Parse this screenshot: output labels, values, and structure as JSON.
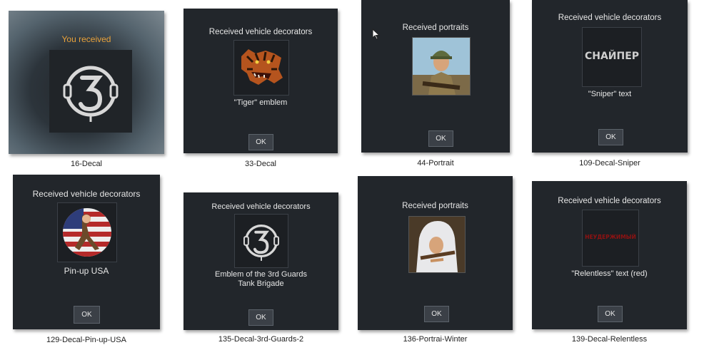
{
  "thumbnails": [
    {
      "caption": "16-Decal",
      "title": "You received",
      "description": "",
      "ok_label": ""
    },
    {
      "caption": "33-Decal",
      "title": "Received vehicle decorators",
      "description": "\"Tiger\" emblem",
      "ok_label": "OK"
    },
    {
      "caption": "44-Portrait",
      "title": "Received portraits",
      "description": "",
      "ok_label": "OK"
    },
    {
      "caption": "109-Decal-Sniper",
      "title": "Received vehicle decorators",
      "description": "\"Sniper\" text",
      "ok_label": "OK",
      "decal_text": "СНАЙПЕР"
    },
    {
      "caption": "129-Decal-Pin-up-USA",
      "title": "Received vehicle decorators",
      "description": "Pin-up USA",
      "ok_label": "OK"
    },
    {
      "caption": "135-Decal-3rd-Guards-2",
      "title": "Received vehicle decorators",
      "description": "Emblem of the 3rd Guards Tank Brigade",
      "ok_label": "OK"
    },
    {
      "caption": "136-Portrai-Winter",
      "title": "Received portraits",
      "description": "",
      "ok_label": "OK"
    },
    {
      "caption": "139-Decal-Relentless",
      "title": "Received vehicle decorators",
      "description": "\"Relentless\" text (red)",
      "ok_label": "OK",
      "decal_text": "НЕУДЕРЖИМЫЙ"
    }
  ],
  "colors": {
    "dialog_bg": "#22262b",
    "title_orange": "#e8a13a",
    "decal_red": "#8f1212"
  },
  "icons": [
    "guards-3-emblem-icon",
    "tiger-emblem-icon",
    "soldier-portrait-icon",
    "pinup-usa-icon",
    "winter-portrait-icon",
    "mouse-cursor-icon"
  ]
}
